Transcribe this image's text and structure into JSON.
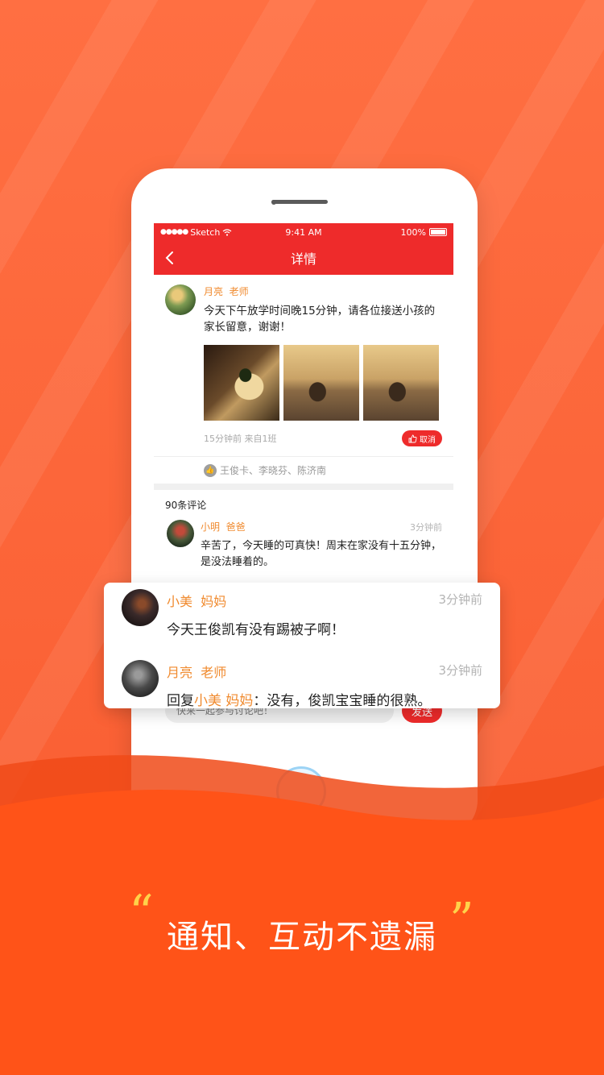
{
  "statusbar": {
    "carrier": "Sketch",
    "time": "9:41 AM",
    "battery": "100%"
  },
  "navbar": {
    "title": "详情"
  },
  "post": {
    "author_name": "月亮",
    "author_role": "老师",
    "text": "今天下午放学时间晚15分钟，请各位接送小孩的家长留意，谢谢！",
    "meta": "15分钟前  来自1班",
    "like_label": "取消",
    "likes": "王俊卡、李晓芬、陈济南"
  },
  "comments": {
    "count_label": "90条评论",
    "items": [
      {
        "name": "小明",
        "role": "爸爸",
        "time": "3分钟前",
        "text": "辛苦了，今天睡的可真快！周末在家没有十五分钟，是没法睡着的。"
      }
    ]
  },
  "floating_comments": [
    {
      "name": "小美",
      "role": "妈妈",
      "time": "3分钟前",
      "text": "今天王俊凯有没有踢被子啊！"
    },
    {
      "name": "月亮",
      "role": "老师",
      "time": "3分钟前",
      "reply_prefix": "回复",
      "reply_to": "小美 妈妈",
      "text": "：没有，俊凯宝宝睡的很熟。"
    }
  ],
  "input": {
    "placeholder": "快来一起参与讨论吧！",
    "send_label": "发送"
  },
  "slogan": "通知、互动不遗漏",
  "quotes": {
    "open": "“",
    "close": "”"
  },
  "colors": {
    "brand_red": "#ee2b2b",
    "name_orange": "#f08a2e",
    "background_orange": "#fb6a3c",
    "quote_yellow": "#ffd24a"
  }
}
